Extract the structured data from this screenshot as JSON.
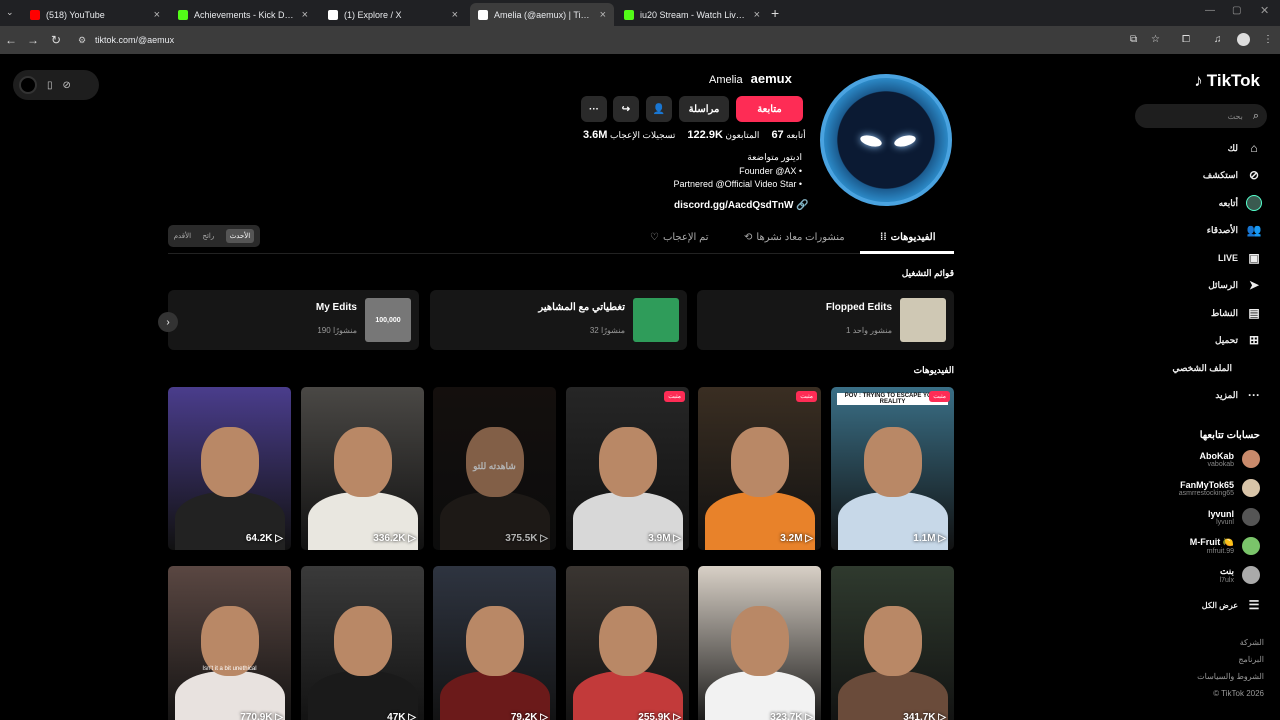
{
  "browser": {
    "tabs": [
      {
        "title": "(518) YouTube",
        "active": false,
        "favicon_color": "#ff0000"
      },
      {
        "title": "Achievements - Kick Dashboard",
        "active": false,
        "favicon_color": "#53fc18"
      },
      {
        "title": "(1) Explore / X",
        "active": false,
        "favicon_color": "#ffffff"
      },
      {
        "title": "Amelia (@aemux) | TikTok",
        "active": true,
        "favicon_color": "#ffffff"
      },
      {
        "title": "iu20 Stream - Watch Live on Ki...",
        "active": false,
        "favicon_color": "#53fc18"
      }
    ],
    "url": "tiktok.com/@aemux"
  },
  "sidebar": {
    "logo": "TikTok",
    "search_placeholder": "بحث",
    "nav": [
      {
        "label": "لك",
        "icon": "home-icon"
      },
      {
        "label": "استكشف",
        "icon": "compass-icon"
      },
      {
        "label": "أتابعه",
        "icon": "following-avatar-icon"
      },
      {
        "label": "الأصدقاء",
        "icon": "friends-icon"
      },
      {
        "label": "LIVE",
        "icon": "live-icon"
      },
      {
        "label": "الرسائل",
        "icon": "send-icon"
      },
      {
        "label": "النشاط",
        "icon": "activity-icon"
      },
      {
        "label": "تحميل",
        "icon": "upload-icon"
      },
      {
        "label": "الملف الشخصي",
        "icon": "profile-avatar-icon"
      },
      {
        "label": "المزيد",
        "icon": "more-icon"
      }
    ],
    "following_heading": "حسابات تتابعها",
    "following": [
      {
        "name": "AboKab",
        "handle": "vabokab",
        "color": "#c98a6b"
      },
      {
        "name": "FanMyTok65",
        "handle": "asmrrestocking65",
        "color": "#d8c4a8"
      },
      {
        "name": "lyvunl",
        "handle": "lyvunl",
        "color": "#555555"
      },
      {
        "name": "M-Fruit 🍋",
        "handle": "mfruit.99",
        "color": "#7ac46a"
      },
      {
        "name": "بنت",
        "handle": "l7ulx",
        "color": "#aaaaaa"
      }
    ],
    "show_all": "عرض الكل",
    "footer": [
      "الشركة",
      "البرنامج",
      "الشروط والسياسات",
      "© TikTok 2026"
    ]
  },
  "recorder": {
    "icons": [
      "record-icon",
      "phone-icon",
      "compass-icon"
    ]
  },
  "profile": {
    "username": "aemux",
    "display_name": "Amelia",
    "follow_button": "متابعة",
    "message_button": "مراسلة",
    "stats": [
      {
        "value": "67",
        "label": "أتابعه"
      },
      {
        "value": "122.9K",
        "label": "المتابعون"
      },
      {
        "value": "3.6M",
        "label": "تسجيلات الإعجاب"
      }
    ],
    "bio": [
      "اديتور متواضعة",
      "Founder @AX •",
      "Partnered @Official Video Star •"
    ],
    "link": "discord.gg/AacdQsdTnW"
  },
  "content_tabs": [
    {
      "label": "الفيديوهات",
      "active": true
    },
    {
      "label": "منشورات معاد نشرها",
      "active": false
    },
    {
      "label": "تم الإعجاب",
      "active": false
    }
  ],
  "sort_options": [
    "الأحدث",
    "رائج",
    "الأقدم"
  ],
  "playlists_heading": "قوائم التشغيل",
  "playlists": [
    {
      "title": "Flopped Edits",
      "count": "1 منشور واحد",
      "thumb_color": "#cfc8b4"
    },
    {
      "title": "تغطياتي مع المشاهير",
      "count": "32 منشورًا",
      "thumb_color": "#2f9c5a"
    },
    {
      "title": "My Edits",
      "count": "190 منشورًا",
      "thumb_color": "#777777",
      "thumb_text": "100,000"
    }
  ],
  "videos_heading": "الفيديوهات",
  "pinned_label": "مثبت",
  "watched_label": "شاهدته للتو",
  "videos": [
    {
      "views": "1.1M",
      "pinned": true,
      "bg": "#3a6f86",
      "body": "#c7d8e8",
      "caption": "POV : TRYING TO ESCAPE YOUR REALITY"
    },
    {
      "views": "3.2M",
      "pinned": true,
      "bg": "#3a2e22",
      "body": "#e8822a"
    },
    {
      "views": "3.9M",
      "pinned": true,
      "bg": "#262626",
      "body": "#d8d8d8"
    },
    {
      "views": "375.5K",
      "pinned": false,
      "bg": "#1c1613",
      "body": "#2a2420",
      "watched": true
    },
    {
      "views": "336.2K",
      "pinned": false,
      "bg": "#4a4845",
      "body": "#e9e7e0"
    },
    {
      "views": "64.2K",
      "pinned": false,
      "bg": "#4a3d8c",
      "body": "#222222"
    },
    {
      "views": "341.7K",
      "pinned": false,
      "bg": "#2f3a2e",
      "body": "#6a4b3a"
    },
    {
      "views": "323.7K",
      "pinned": false,
      "bg": "#d8d0c6",
      "body": "#f2f2f2"
    },
    {
      "views": "255.9K",
      "pinned": false,
      "bg": "#3a3531",
      "body": "#c23a3a"
    },
    {
      "views": "79.2K",
      "pinned": false,
      "bg": "#2e3440",
      "body": "#6b1a1a"
    },
    {
      "views": "47K",
      "pinned": false,
      "bg": "#3a3a3a",
      "body": "#1a1a1a"
    },
    {
      "views": "770.9K",
      "pinned": false,
      "bg": "#5a4742",
      "body": "#e8e2df",
      "caption": "Isn't it a bit unethical"
    }
  ]
}
